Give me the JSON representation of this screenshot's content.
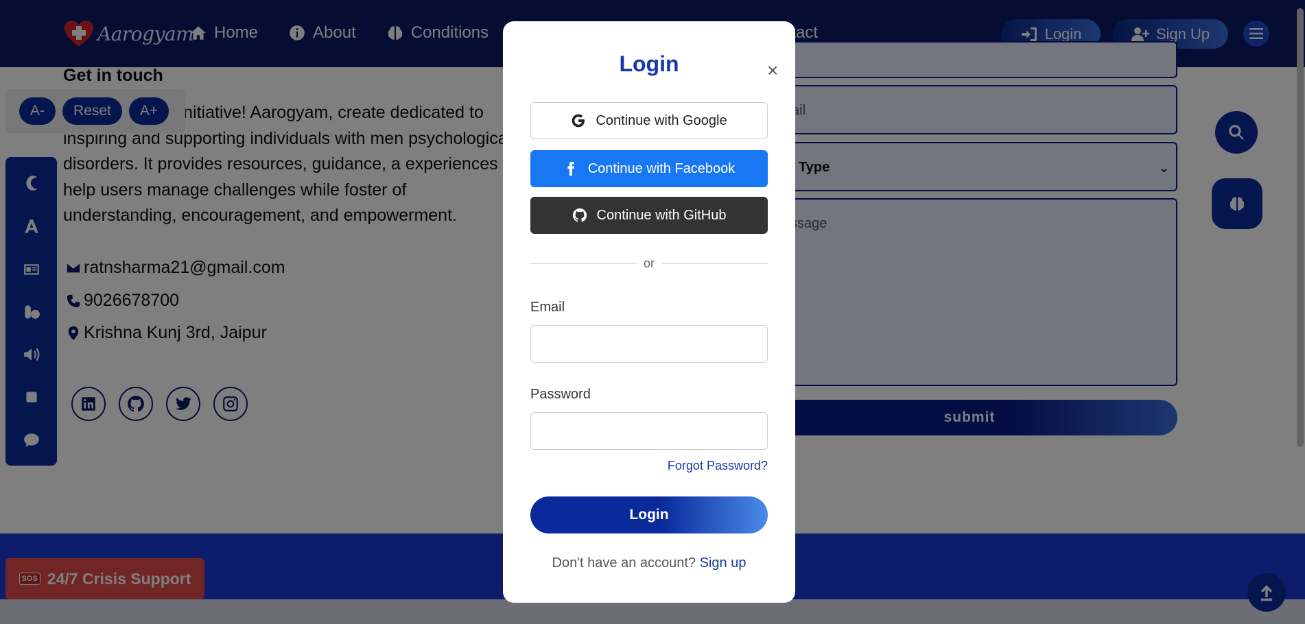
{
  "brand": {
    "name": "Aarogyam"
  },
  "nav": {
    "items": [
      {
        "label": "Home",
        "icon": "home-icon"
      },
      {
        "label": "About",
        "icon": "info-icon"
      },
      {
        "label": "Conditions",
        "icon": "brain-icon"
      }
    ],
    "contact_partial": "ntact",
    "login_label": "Login",
    "signup_label": "Sign Up"
  },
  "font_controls": {
    "decrease": "A-",
    "reset": "Reset",
    "increase": "A+"
  },
  "contact": {
    "heading": "Get in touch",
    "intro": "e an incredible initiative! Aarogyam, create dedicated to inspiring and supporting individuals with men psychological disorders. It provides resources, guidance, a experiences to help users manage challenges while foster of understanding, encouragement, and empowerment.",
    "email": "ratnsharma21@gmail.com",
    "phone": "9026678700",
    "address": "Krishna Kunj 3rd, Jaipur"
  },
  "form": {
    "email_partial": "ail",
    "type_partial": "Type",
    "message_partial": "ssage",
    "submit_label": "submit"
  },
  "crisis": {
    "badge": "SOS",
    "label": "24/7 Crisis Support"
  },
  "modal": {
    "title": "Login",
    "close": "×",
    "google": "Continue with Google",
    "facebook": "Continue with Facebook",
    "github": "Continue with GitHub",
    "divider": "or",
    "email_label": "Email",
    "password_label": "Password",
    "email_value": "",
    "password_value": "",
    "forgot": "Forgot Password?",
    "submit": "Login",
    "signup_prompt": "Don't have an account?",
    "signup_link": "Sign up"
  },
  "colors": {
    "navbar": "#0a1a66",
    "accent": "#0a2a9a",
    "title_blue": "#1537a8",
    "facebook": "#1877f2",
    "github": "#333333",
    "crisis": "#e44b4b"
  }
}
